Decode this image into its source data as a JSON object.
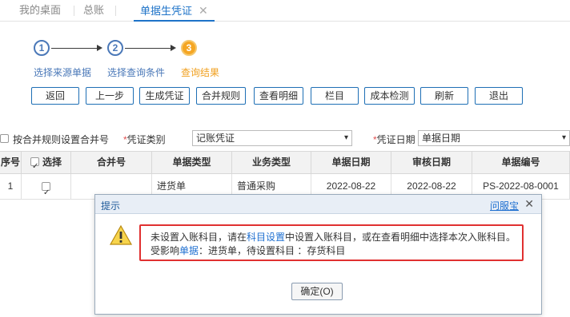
{
  "tabs": [
    {
      "label": "我的桌面"
    },
    {
      "label": "总账"
    },
    {
      "label": "单据生凭证",
      "active": true
    }
  ],
  "steps": [
    {
      "number": "1",
      "label": "选择来源单据"
    },
    {
      "number": "2",
      "label": "选择查询条件"
    },
    {
      "number": "3",
      "label": "查询结果",
      "current": true
    }
  ],
  "toolbar": {
    "back": "返回",
    "prev": "上一步",
    "generate": "生成凭证",
    "merge_rule": "合并规则",
    "view_detail": "查看明细",
    "columns": "栏目",
    "cost_check": "成本检测",
    "refresh": "刷新",
    "exit": "退出"
  },
  "filters": {
    "merge_by_rule_label": "按合并规则设置合并号",
    "voucher_type_label": "凭证类别",
    "voucher_type_value": "记账凭证",
    "voucher_date_label": "凭证日期",
    "voucher_date_value": "单据日期",
    "required_mark": "*"
  },
  "table": {
    "headers": {
      "seq": "序号",
      "select": "选择",
      "merge_no": "合并号",
      "doc_type": "单据类型",
      "biz_type": "业务类型",
      "doc_date": "单据日期",
      "audit_date": "审核日期",
      "doc_no": "单据编号"
    },
    "rows": [
      {
        "seq": "1",
        "selected": true,
        "merge_no": "",
        "doc_type": "进货单",
        "biz_type": "普通采购",
        "doc_date": "2022-08-22",
        "audit_date": "2022-08-22",
        "doc_no": "PS-2022-08-0001"
      }
    ]
  },
  "dialog": {
    "title": "提示",
    "help_link": "问服宝",
    "close": "✕",
    "message_line1_a": "未设置入账科目，请在",
    "message_line1_link": "科目设置",
    "message_line1_b": "中设置入账科目，或在查看明细中选择本次入账科目。",
    "message_line2_a": "受影响",
    "message_line2_link": "单据",
    "message_line2_b": "：进货单，待设置科目 ：存货科目",
    "ok_button": "确定(O)"
  },
  "colors": {
    "accent": "#1e73c8",
    "step_current": "#f5a623",
    "highlight_border": "#e03030"
  }
}
